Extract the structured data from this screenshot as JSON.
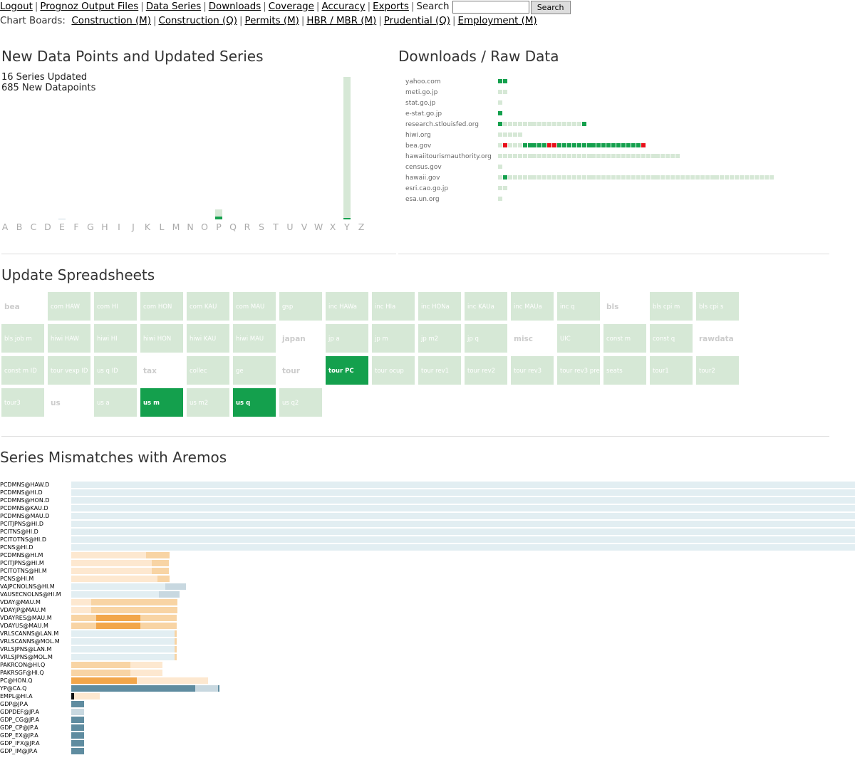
{
  "nav": {
    "links": [
      "Logout",
      "Prognoz Output Files",
      "Data Series",
      "Downloads",
      "Coverage",
      "Accuracy",
      "Exports"
    ],
    "search_label": "Search",
    "search_value": "",
    "search_button": "Search",
    "chart_boards_label": "Chart Boards:",
    "chart_boards": [
      "Construction (M)",
      "Construction (Q)",
      "Permits (M)",
      "HBR / MBR (M)",
      "Prudential (Q)",
      "Employment (M)"
    ]
  },
  "new_data": {
    "title": "New Data Points and Updated Series",
    "series_updated": "16 Series Updated",
    "new_datapoints": "685 New Datapoints",
    "letters": [
      "A",
      "B",
      "C",
      "D",
      "E",
      "F",
      "G",
      "H",
      "I",
      "J",
      "K",
      "L",
      "M",
      "N",
      "O",
      "P",
      "Q",
      "R",
      "S",
      "T",
      "U",
      "V",
      "W",
      "X",
      "Y",
      "Z"
    ],
    "bars": [
      {
        "letter": "E",
        "series_frac": 0.0,
        "points_frac": 0.005
      },
      {
        "letter": "P",
        "series_frac": 0.07,
        "points_frac": 0.02
      },
      {
        "letter": "Y",
        "series_frac": 1.0,
        "points_frac": 0.01
      }
    ],
    "colors": {
      "series": "#d6e8d6",
      "points": "#14a04d"
    }
  },
  "downloads": {
    "title": "Downloads / Raw Data",
    "colors": {
      "ok": "#14a04d",
      "stale": "#d6e8d6",
      "error": "#e8101a"
    },
    "sources": [
      {
        "name": "yahoo.com",
        "status": "GG"
      },
      {
        "name": "meti.go.jp",
        "status": "LL"
      },
      {
        "name": "stat.go.jp",
        "status": "L"
      },
      {
        "name": "e-stat.go.jp",
        "status": "G"
      },
      {
        "name": "research.stlouisfed.org",
        "status": "GLLLLLLLLLLLLLLLLG"
      },
      {
        "name": "hiwi.org",
        "status": "LLLLL"
      },
      {
        "name": "bea.gov",
        "status": "LRLLLGGGGGRRGGGGGGGGGGGGGGGGGR"
      },
      {
        "name": "hawaiitourismauthority.org",
        "status": "LLLLLLLLLLLLLLLLLLLLLLLLLLLLLLLLLLLLL"
      },
      {
        "name": "census.gov",
        "status": "L"
      },
      {
        "name": "hawaii.gov",
        "status": "LGLLLLLLLLLLLLLLLLLLLLLLLLLLLLLLLLLLLLLLLLLLLLLLLLLLLLLL"
      },
      {
        "name": "esri.cao.go.jp",
        "status": "LL"
      },
      {
        "name": "esa.un.org",
        "status": "L"
      }
    ]
  },
  "spreadsheets": {
    "title": "Update Spreadsheets",
    "items": [
      {
        "label": "bea",
        "kind": "h"
      },
      {
        "label": "com HAW",
        "kind": "g"
      },
      {
        "label": "com HI",
        "kind": "g"
      },
      {
        "label": "com HON",
        "kind": "g"
      },
      {
        "label": "com KAU",
        "kind": "g"
      },
      {
        "label": "com MAU",
        "kind": "g"
      },
      {
        "label": "gsp",
        "kind": "g"
      },
      {
        "label": "inc HAWa",
        "kind": "g"
      },
      {
        "label": "inc HIa",
        "kind": "g"
      },
      {
        "label": "inc HONa",
        "kind": "g"
      },
      {
        "label": "inc KAUa",
        "kind": "g"
      },
      {
        "label": "inc MAUa",
        "kind": "g"
      },
      {
        "label": "inc q",
        "kind": "g"
      },
      {
        "label": "bls",
        "kind": "h"
      },
      {
        "label": "bls cpi m",
        "kind": "g"
      },
      {
        "label": "bls cpi s",
        "kind": "g"
      },
      {
        "label": "bls job m",
        "kind": "g"
      },
      {
        "label": "hiwi HAW",
        "kind": "g"
      },
      {
        "label": "hiwi HI",
        "kind": "g"
      },
      {
        "label": "hiwi HON",
        "kind": "g"
      },
      {
        "label": "hiwi KAU",
        "kind": "g"
      },
      {
        "label": "hiwi MAU",
        "kind": "g"
      },
      {
        "label": "japan",
        "kind": "h"
      },
      {
        "label": "jp a",
        "kind": "g"
      },
      {
        "label": "jp m",
        "kind": "g"
      },
      {
        "label": "jp m2",
        "kind": "g"
      },
      {
        "label": "jp q",
        "kind": "g"
      },
      {
        "label": "misc",
        "kind": "h"
      },
      {
        "label": "UIC",
        "kind": "g"
      },
      {
        "label": "const m",
        "kind": "g"
      },
      {
        "label": "const q",
        "kind": "g"
      },
      {
        "label": "rawdata",
        "kind": "h"
      },
      {
        "label": "const m ID",
        "kind": "g"
      },
      {
        "label": "tour vexp ID",
        "kind": "g"
      },
      {
        "label": "us q ID",
        "kind": "g"
      },
      {
        "label": "tax",
        "kind": "h"
      },
      {
        "label": "collec",
        "kind": "g"
      },
      {
        "label": "ge",
        "kind": "g"
      },
      {
        "label": "tour",
        "kind": "h"
      },
      {
        "label": "tour PC",
        "kind": "d"
      },
      {
        "label": "tour ocup",
        "kind": "g"
      },
      {
        "label": "tour rev1",
        "kind": "g"
      },
      {
        "label": "tour rev2",
        "kind": "g"
      },
      {
        "label": "tour rev3",
        "kind": "g"
      },
      {
        "label": "tour rev3 pre",
        "kind": "g"
      },
      {
        "label": "seats",
        "kind": "g"
      },
      {
        "label": "tour1",
        "kind": "g"
      },
      {
        "label": "tour2",
        "kind": "g"
      },
      {
        "label": "tour3",
        "kind": "g"
      },
      {
        "label": "us",
        "kind": "h"
      },
      {
        "label": "us a",
        "kind": "g"
      },
      {
        "label": "us m",
        "kind": "d"
      },
      {
        "label": "us m2",
        "kind": "g"
      },
      {
        "label": "us q",
        "kind": "d"
      },
      {
        "label": "us q2",
        "kind": "g"
      }
    ]
  },
  "mismatches": {
    "title": "Series Mismatches with Aremos",
    "colors": {
      "blue_light": "#e2eef2",
      "blue_mid": "#c8d8e0",
      "blue_dark": "#5f8ca0",
      "orange_light": "#fde8d0",
      "orange_mid": "#f8d4a4",
      "orange_dark": "#f2a64a",
      "black": "#111111"
    },
    "rows": [
      {
        "name": "PCDMNS@HAW.D",
        "segs": [
          [
            "blue_light",
            100
          ]
        ]
      },
      {
        "name": "PCDMNS@HI.D",
        "segs": [
          [
            "blue_light",
            100
          ]
        ]
      },
      {
        "name": "PCDMNS@HON.D",
        "segs": [
          [
            "blue_light",
            100
          ]
        ]
      },
      {
        "name": "PCDMNS@KAU.D",
        "segs": [
          [
            "blue_light",
            100
          ]
        ]
      },
      {
        "name": "PCDMNS@MAU.D",
        "segs": [
          [
            "blue_light",
            100
          ]
        ]
      },
      {
        "name": "PCITJPNS@HI.D",
        "segs": [
          [
            "blue_light",
            100
          ]
        ]
      },
      {
        "name": "PCITNS@HI.D",
        "segs": [
          [
            "blue_light",
            100
          ]
        ]
      },
      {
        "name": "PCITOTNS@HI.D",
        "segs": [
          [
            "blue_light",
            100
          ]
        ]
      },
      {
        "name": "PCNS@HI.D",
        "segs": [
          [
            "blue_light",
            100
          ]
        ]
      },
      {
        "name": "PCDMNS@HI.M",
        "segs": [
          [
            "orange_light",
            9.5
          ],
          [
            "orange_mid",
            3
          ]
        ]
      },
      {
        "name": "PCITJPNS@HI.M",
        "segs": [
          [
            "orange_light",
            10.3
          ],
          [
            "orange_mid",
            2.2
          ]
        ]
      },
      {
        "name": "PCITOTNS@HI.M",
        "segs": [
          [
            "orange_light",
            10.3
          ],
          [
            "orange_mid",
            2.2
          ]
        ]
      },
      {
        "name": "PCNS@HI.M",
        "segs": [
          [
            "orange_light",
            11
          ],
          [
            "orange_mid",
            1.5
          ]
        ]
      },
      {
        "name": "VAJPCNOLNS@HI.M",
        "segs": [
          [
            "blue_light",
            12
          ],
          [
            "blue_mid",
            2.6
          ]
        ]
      },
      {
        "name": "VAUSECNOLNS@HI.M",
        "segs": [
          [
            "blue_light",
            11.2
          ],
          [
            "blue_mid",
            2.6
          ]
        ]
      },
      {
        "name": "VDAY@MAU.M",
        "segs": [
          [
            "orange_light",
            2.5
          ],
          [
            "orange_mid",
            11
          ]
        ]
      },
      {
        "name": "VDAYJP@MAU.M",
        "segs": [
          [
            "orange_light",
            2.5
          ],
          [
            "orange_mid",
            11
          ]
        ]
      },
      {
        "name": "VDAYRES@MAU.M",
        "segs": [
          [
            "orange_mid",
            3.2
          ],
          [
            "orange_dark",
            5.6
          ],
          [
            "orange_mid",
            4.7
          ]
        ]
      },
      {
        "name": "VDAYUS@MAU.M",
        "segs": [
          [
            "orange_mid",
            3.2
          ],
          [
            "orange_dark",
            5.6
          ],
          [
            "orange_mid",
            4.7
          ]
        ]
      },
      {
        "name": "VRLSCANNS@LAN.M",
        "segs": [
          [
            "blue_light",
            13.2
          ],
          [
            "orange_mid",
            0.3
          ]
        ]
      },
      {
        "name": "VRLSCANNS@MOL.M",
        "segs": [
          [
            "blue_light",
            13.2
          ],
          [
            "orange_mid",
            0.3
          ]
        ]
      },
      {
        "name": "VRLSJPNS@LAN.M",
        "segs": [
          [
            "blue_light",
            13.2
          ],
          [
            "orange_mid",
            0.3
          ]
        ]
      },
      {
        "name": "VRLSJPNS@MOL.M",
        "segs": [
          [
            "blue_light",
            13.2
          ],
          [
            "orange_mid",
            0.3
          ]
        ]
      },
      {
        "name": "PAKRCON@HI.Q",
        "segs": [
          [
            "orange_mid",
            7.5
          ],
          [
            "orange_light",
            4.1
          ]
        ]
      },
      {
        "name": "PAKRSGF@HI.Q",
        "segs": [
          [
            "orange_mid",
            7.5
          ],
          [
            "orange_light",
            4.1
          ]
        ]
      },
      {
        "name": "PC@HON.Q",
        "segs": [
          [
            "orange_dark",
            8.4
          ],
          [
            "orange_light",
            9.1
          ]
        ]
      },
      {
        "name": "YP@CA.Q",
        "segs": [
          [
            "blue_dark",
            15.8
          ],
          [
            "blue_mid",
            2.9
          ],
          [
            "blue_dark",
            0.2
          ]
        ]
      },
      {
        "name": "EMPL@HI.A",
        "segs": [
          [
            "black",
            0.4
          ],
          [
            "orange_light",
            3.2
          ]
        ]
      },
      {
        "name": "GDP@JP.A",
        "segs": [
          [
            "blue_dark",
            1.6
          ]
        ]
      },
      {
        "name": "GDPDEF@JP.A",
        "segs": [
          [
            "blue_mid",
            1.6
          ]
        ]
      },
      {
        "name": "GDP_CG@JP.A",
        "segs": [
          [
            "blue_dark",
            1.6
          ]
        ]
      },
      {
        "name": "GDP_CP@JP.A",
        "segs": [
          [
            "blue_dark",
            1.6
          ]
        ]
      },
      {
        "name": "GDP_EX@JP.A",
        "segs": [
          [
            "blue_dark",
            1.6
          ]
        ]
      },
      {
        "name": "GDP_IFX@JP.A",
        "segs": [
          [
            "blue_dark",
            1.6
          ]
        ]
      },
      {
        "name": "GDP_IM@JP.A",
        "segs": [
          [
            "blue_dark",
            1.6
          ]
        ]
      }
    ]
  }
}
